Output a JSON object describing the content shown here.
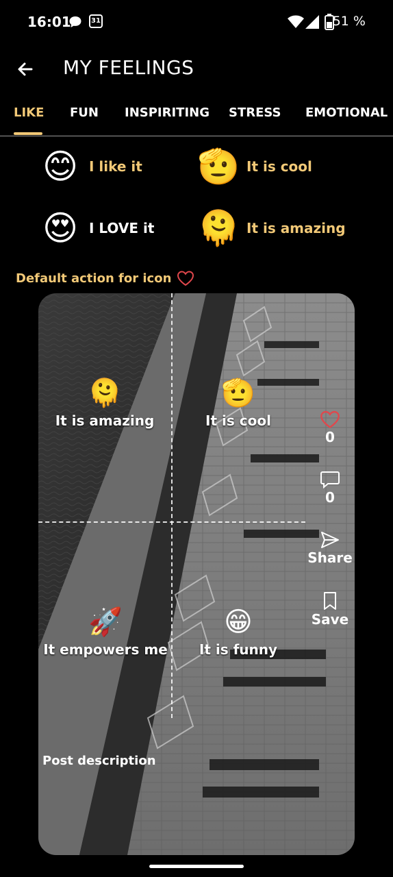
{
  "status": {
    "time": "16:01",
    "calendar_day": "31",
    "battery": "51 %"
  },
  "header": {
    "title": "MY FEELINGS"
  },
  "tabs": [
    {
      "label": "LIKE",
      "active": true
    },
    {
      "label": "FUN"
    },
    {
      "label": "INSPIRITING"
    },
    {
      "label": "STRESS"
    },
    {
      "label": "EMOTIONAL"
    }
  ],
  "feelings": [
    {
      "emoji": "😊",
      "label": "I like it"
    },
    {
      "emoji": "🫡",
      "label": "It is cool"
    },
    {
      "emoji": "😍",
      "label": "I LOVE it"
    },
    {
      "emoji": "🫠",
      "label": "It is amazing"
    }
  ],
  "default_action": {
    "label": "Default action for icon",
    "icon": "heart-outline-icon"
  },
  "post": {
    "quadrants": [
      {
        "emoji": "🫠",
        "label": "It is amazing"
      },
      {
        "emoji": "🫡",
        "label": "It is cool"
      },
      {
        "emoji": "🚀",
        "label": "It empowers me"
      },
      {
        "emoji": "😁",
        "label": "It is funny"
      }
    ],
    "likes": "0",
    "comments": "0",
    "share_label": "Share",
    "save_label": "Save",
    "description": "Post description"
  },
  "colors": {
    "accent": "#f2c977",
    "heart": "#e0474c",
    "background": "#000000"
  }
}
